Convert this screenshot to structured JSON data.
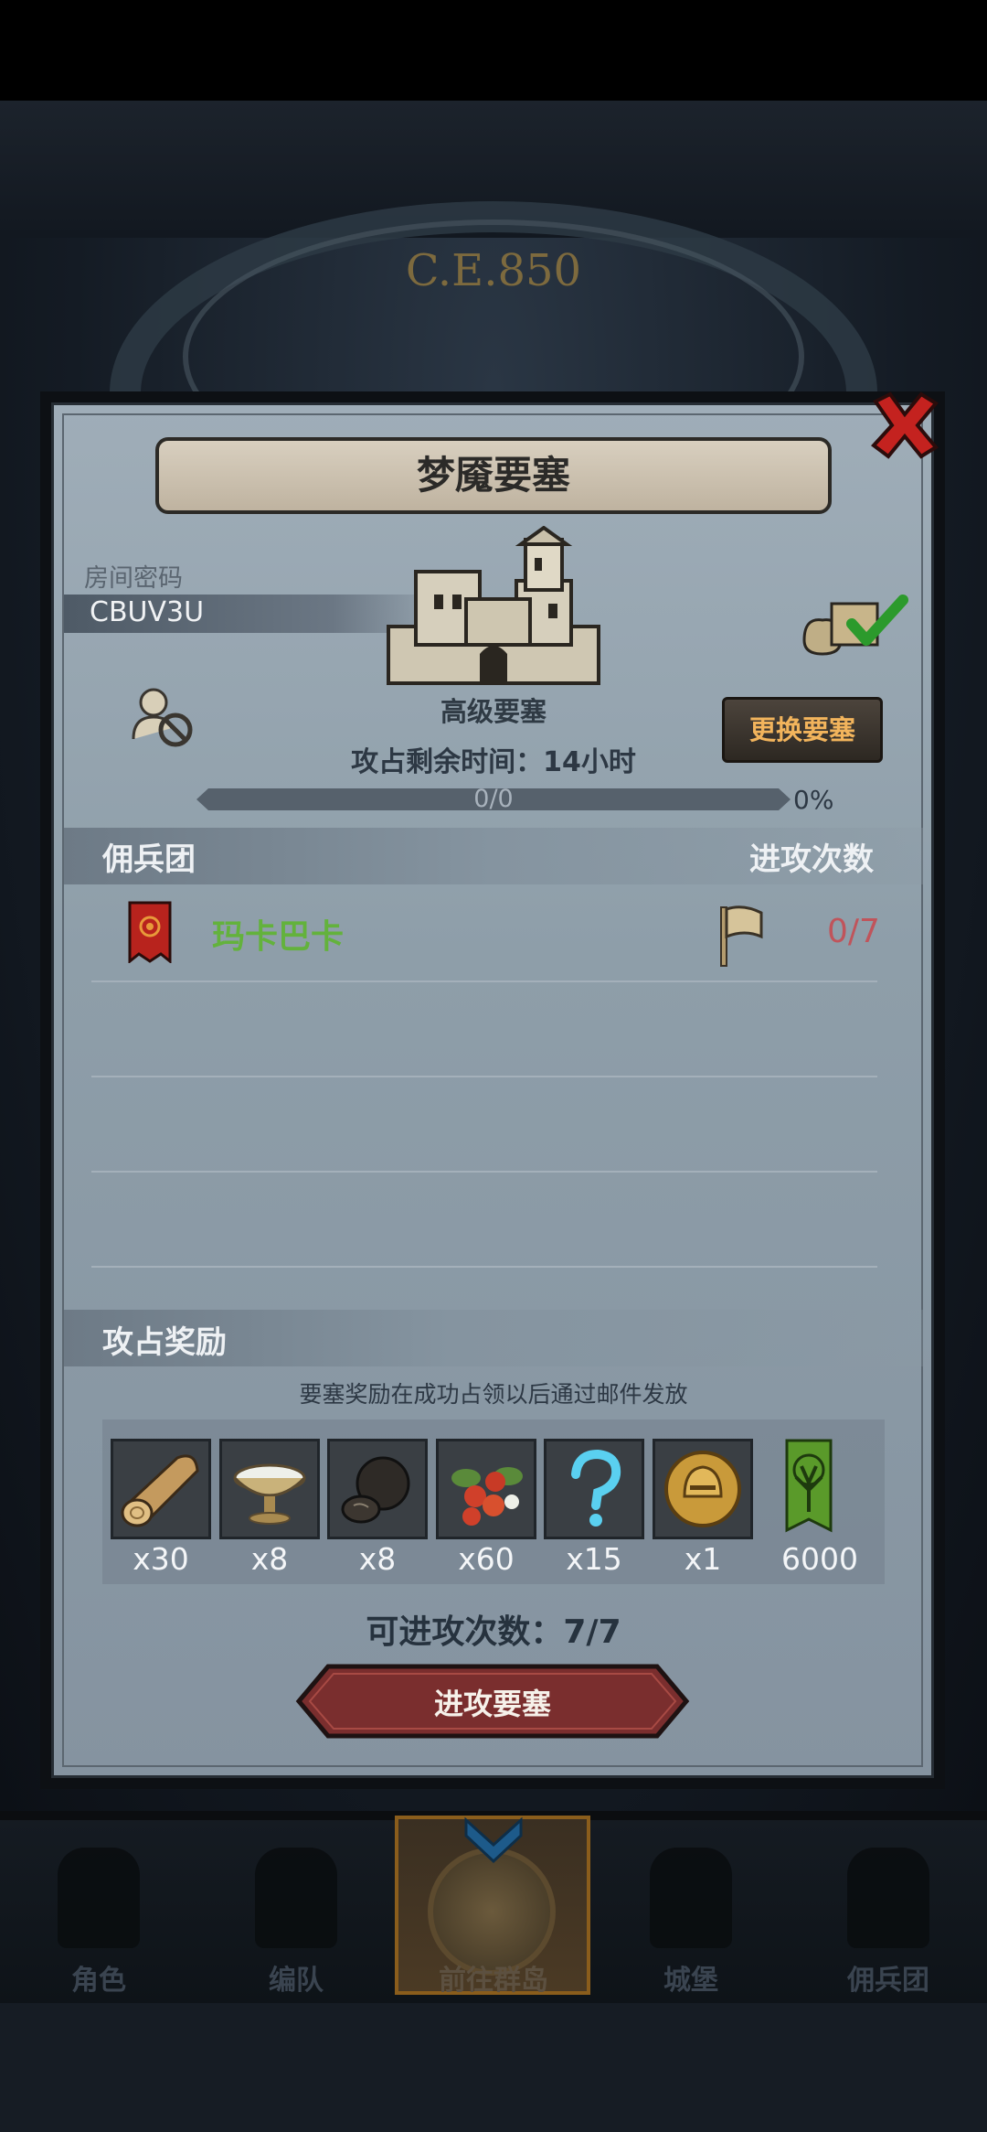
{
  "background": {
    "era_text": "C.E.850"
  },
  "modal": {
    "title": "梦魇要塞",
    "room_password_label": "房间密码",
    "room_password_value": "CBUV3U",
    "fortress_level": "高级要塞",
    "change_fortress_label": "更换要塞",
    "time_remaining": "攻占剩余时间：14小时",
    "progress": {
      "text": "0/0",
      "percent_text": "0%",
      "fraction": 0
    },
    "mercenary_header": "佣兵团",
    "attack_count_header": "进攻次数",
    "guilds": [
      {
        "name": "玛卡巴卡",
        "attacks": "0/7"
      }
    ],
    "reward_header": "攻占奖励",
    "reward_note": "要塞奖励在成功占领以后通过邮件发放",
    "rewards": [
      {
        "icon": "wood-log-icon",
        "qty": "x30"
      },
      {
        "icon": "silver-bowl-icon",
        "qty": "x8"
      },
      {
        "icon": "truffle-icon",
        "qty": "x8"
      },
      {
        "icon": "berries-icon",
        "qty": "x60"
      },
      {
        "icon": "question-mark-icon",
        "qty": "x15"
      },
      {
        "icon": "gold-helmet-coin-icon",
        "qty": "x1"
      },
      {
        "icon": "tree-banner-icon",
        "qty": "6000"
      }
    ],
    "available_attacks": "可进攻次数：7/7",
    "attack_button_label": "进攻要塞"
  },
  "bottom_nav": {
    "items": [
      {
        "label": "角色",
        "icon": "knight-icon"
      },
      {
        "label": "编队",
        "icon": "helmet-icon"
      },
      {
        "label": "前往群岛",
        "icon": "map-emblem-icon",
        "active": true
      },
      {
        "label": "城堡",
        "icon": "castle-icon"
      },
      {
        "label": "佣兵团",
        "icon": "warrior-icon"
      }
    ]
  },
  "colors": {
    "guild_name": "#63b23c",
    "attack_count": "#c0545b",
    "change_button_text": "#f2b45c",
    "attack_button": "#7a2e2e"
  }
}
